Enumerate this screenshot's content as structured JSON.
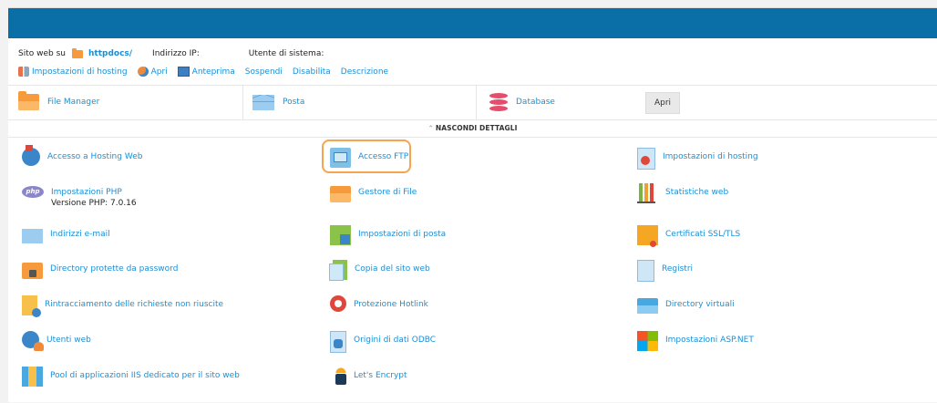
{
  "header": {
    "site_label": "Sito web su",
    "site_folder": "httpdocs/",
    "ip_label": "Indirizzo IP:",
    "user_label": "Utente di sistema:"
  },
  "actions": [
    {
      "label": "Impostazioni di hosting",
      "icon": "tools-icon"
    },
    {
      "label": "Apri",
      "icon": "globe-icon"
    },
    {
      "label": "Anteprima",
      "icon": "preview-icon"
    },
    {
      "label": "Sospendi"
    },
    {
      "label": "Disabilita"
    },
    {
      "label": "Descrizione"
    }
  ],
  "tabs": {
    "file_manager": "File Manager",
    "mail": "Posta",
    "database": "Database",
    "open_button": "Apri"
  },
  "toggle_label": "NASCONDI DETTAGLI",
  "grid": [
    [
      "Accesso a Hosting Web",
      "Accesso FTP",
      "Impostazioni di hosting"
    ],
    [
      "Impostazioni PHP",
      "Gestore di File",
      "Statistiche web"
    ],
    [
      "Indirizzi e-mail",
      "Impostazioni di posta",
      "Certificati SSL/TLS"
    ],
    [
      "Directory protette da password",
      "Copia del sito web",
      "Registri"
    ],
    [
      "Rintracciamento delle richieste non riuscite",
      "Protezione Hotlink",
      "Directory virtuali"
    ],
    [
      "Utenti web",
      "Origini di dati ODBC",
      "Impostazioni ASP.NET"
    ],
    [
      "Pool di applicazioni IIS dedicato per il sito web",
      "Let's Encrypt",
      ""
    ]
  ],
  "php_version": "Versione PHP: 7.0.16",
  "colors": {
    "header": "#0a6fa6",
    "link": "#1a8fd6",
    "highlight": "#f5a54e"
  }
}
